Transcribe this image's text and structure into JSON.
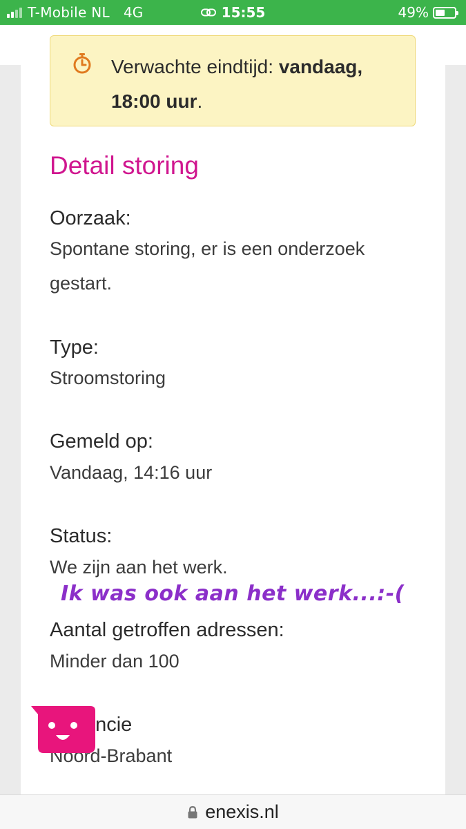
{
  "status_bar": {
    "carrier": "T-Mobile NL",
    "network": "4G",
    "time": "15:55",
    "battery_percent": "49%",
    "battery_level": 0.49,
    "icons": [
      "signal-icon",
      "link-icon",
      "battery-icon"
    ]
  },
  "notice": {
    "icon": "timer-icon",
    "label": "Verwachte eindtijd: ",
    "value_line1": "vandaag,",
    "value_line2": "18:00 uur",
    "value_end": "."
  },
  "detail": {
    "title": "Detail storing",
    "fields": [
      {
        "label": "Oorzaak:",
        "value": "Spontane storing, er is een onderzoek gestart."
      },
      {
        "label": "Type:",
        "value": "Stroomstoring"
      },
      {
        "label": "Gemeld op:",
        "value": "Vandaag, 14:16 uur"
      },
      {
        "label": "Status:",
        "value": "We zijn aan het werk."
      },
      {
        "label": "Aantal getroffen adressen:",
        "value": "Minder dan 100"
      },
      {
        "label": "Provincie",
        "value": "Noord-Brabant"
      }
    ]
  },
  "annotation": "Ik was ook aan het werk...:-(",
  "chat_button": {
    "icon": "chat-face-icon"
  },
  "url_bar": {
    "icon": "lock-icon",
    "domain": "enexis.nl"
  },
  "colors": {
    "status_bar": "#3cb44b",
    "accent": "#d0168f",
    "notice_bg": "#fcf4c3",
    "notice_border": "#efd97a",
    "timer_icon": "#e07a1f",
    "annotation": "#8b2fc9"
  }
}
